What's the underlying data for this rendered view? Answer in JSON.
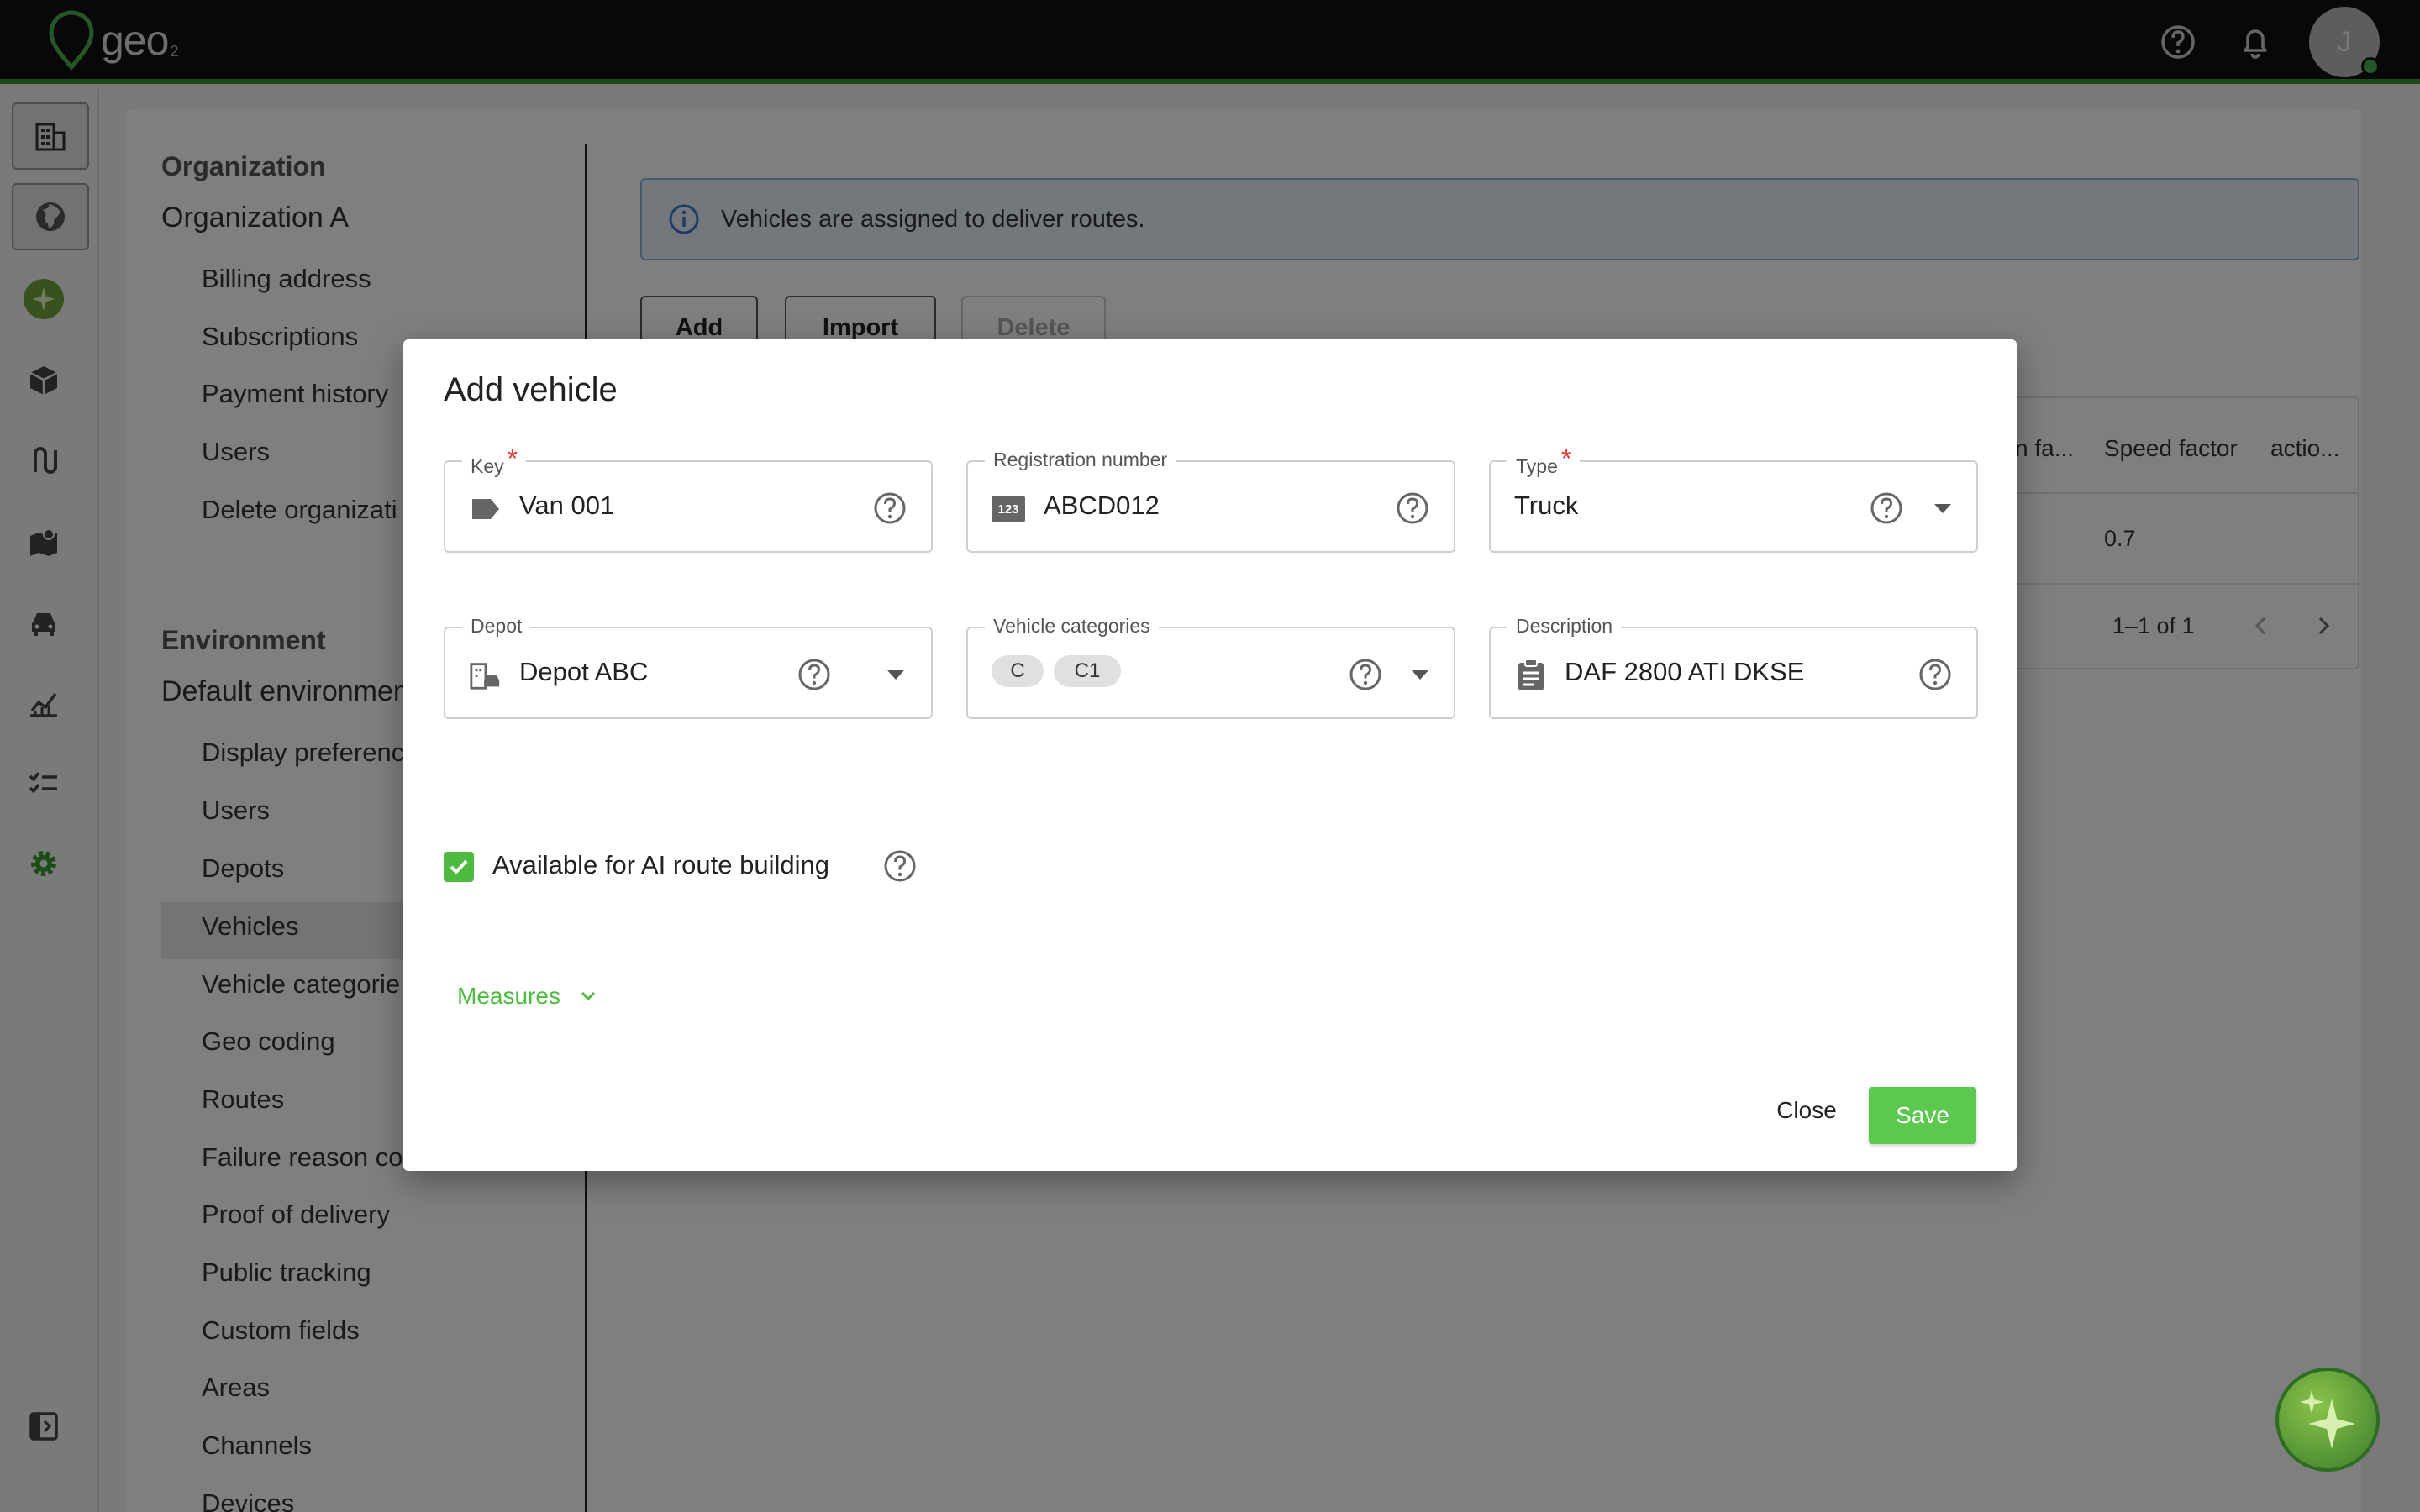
{
  "app": {
    "logo_text": "geo",
    "logo_sub": "2"
  },
  "header": {
    "avatar_initial": "J"
  },
  "settings_nav": {
    "org_heading": "Organization",
    "org_name": "Organization A",
    "org_items": [
      "Billing address",
      "Subscriptions",
      "Payment history",
      "Users",
      "Delete organizati"
    ],
    "env_heading": "Environment",
    "env_name": "Default environmen",
    "env_items": [
      "Display preferenc",
      "Users",
      "Depots",
      "Vehicles",
      "Vehicle categorie",
      "Geo coding",
      "Routes",
      "Failure reason co",
      "Proof of delivery",
      "Public tracking",
      "Custom fields",
      "Areas",
      "Channels",
      "Devices"
    ],
    "selected": "Vehicles"
  },
  "page": {
    "info_text": "Vehicles are assigned to deliver routes.",
    "toolbar": {
      "add": "Add",
      "import": "Import",
      "delete": "Delete"
    },
    "table": {
      "headers": [
        "n fa...",
        "Speed factor",
        "actio..."
      ],
      "rows": [
        [
          "",
          "0.7",
          ""
        ]
      ],
      "pagination": "1–1 of 1"
    }
  },
  "modal": {
    "title": "Add vehicle",
    "fields": {
      "key": {
        "label": "Key",
        "value": "Van 001",
        "required": true
      },
      "registration": {
        "label": "Registration number",
        "value": "ABCD012",
        "icon_text": "123"
      },
      "type": {
        "label": "Type",
        "value": "Truck",
        "required": true
      },
      "depot": {
        "label": "Depot",
        "value": "Depot ABC"
      },
      "categories": {
        "label": "Vehicle categories",
        "chips": [
          "C",
          "C1"
        ]
      },
      "description": {
        "label": "Description",
        "value": "DAF 2800 ATI DKSE"
      }
    },
    "ai_checkbox": {
      "label": "Available for AI route building",
      "checked": true
    },
    "measures_label": "Measures",
    "close_label": "Close",
    "save_label": "Save"
  },
  "colors": {
    "accent": "#4cbb3f",
    "topbar": "#111111",
    "required": "#e53935"
  },
  "icons": [
    "help-icon",
    "bell-icon",
    "building-icon",
    "globe-icon",
    "box-icon",
    "route-icon",
    "map-icon",
    "car-icon",
    "chart-icon",
    "checklist-icon",
    "gear-icon",
    "sidebar-toggle-icon",
    "sparkle-icon"
  ]
}
